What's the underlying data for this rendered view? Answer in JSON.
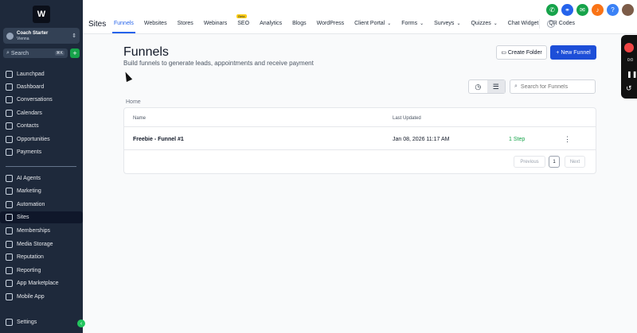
{
  "sidebar": {
    "logo_letter": "W",
    "account": {
      "name": "Coach Starter",
      "location": "Vienna"
    },
    "search": {
      "placeholder": "Search",
      "shortcut": "⌘K"
    },
    "items_top": [
      {
        "label": "Launchpad"
      },
      {
        "label": "Dashboard"
      },
      {
        "label": "Conversations"
      },
      {
        "label": "Calendars"
      },
      {
        "label": "Contacts"
      },
      {
        "label": "Opportunities"
      },
      {
        "label": "Payments"
      }
    ],
    "items_bottom": [
      {
        "label": "AI Agents"
      },
      {
        "label": "Marketing"
      },
      {
        "label": "Automation"
      },
      {
        "label": "Sites",
        "active": true
      },
      {
        "label": "Memberships"
      },
      {
        "label": "Media Storage"
      },
      {
        "label": "Reputation"
      },
      {
        "label": "Reporting"
      },
      {
        "label": "App Marketplace"
      },
      {
        "label": "Mobile App"
      }
    ],
    "settings_label": "Settings"
  },
  "header": {
    "title": "Sites",
    "tabs": [
      {
        "label": "Funnels",
        "active": true
      },
      {
        "label": "Websites"
      },
      {
        "label": "Stores"
      },
      {
        "label": "Webinars"
      },
      {
        "label": "SEO",
        "badge": "Beta"
      },
      {
        "label": "Analytics"
      },
      {
        "label": "Blogs"
      },
      {
        "label": "WordPress"
      },
      {
        "label": "Client Portal",
        "dropdown": true
      },
      {
        "label": "Forms",
        "dropdown": true
      },
      {
        "label": "Surveys",
        "dropdown": true
      },
      {
        "label": "Quizzes",
        "dropdown": true
      },
      {
        "label": "Chat Widget"
      },
      {
        "label": "QR Codes"
      }
    ],
    "icons": [
      {
        "name": "phone-icon",
        "color": "#16a34a"
      },
      {
        "name": "link-icon",
        "color": "#2563eb"
      },
      {
        "name": "megaphone-icon",
        "color": "#16a34a"
      },
      {
        "name": "notification-icon",
        "color": "#f97316"
      },
      {
        "name": "help-icon",
        "color": "#3b82f6"
      },
      {
        "name": "avatar",
        "color": "#7c5c48"
      }
    ]
  },
  "main": {
    "title": "Funnels",
    "subtitle": "Build funnels to generate leads, appointments and receive payment",
    "create_folder_label": "Create Folder",
    "new_funnel_label": "+ New Funnel",
    "search_placeholder": "Search for Funnels",
    "breadcrumb": "Home",
    "table": {
      "columns": [
        "Name",
        "Last Updated"
      ],
      "rows": [
        {
          "name": "Freebie - Funnel #1",
          "updated": "Jan 08, 2026 11:17 AM",
          "steps": "1 Step"
        }
      ]
    },
    "pagination": {
      "prev": "Previous",
      "current": "1",
      "next": "Next"
    }
  },
  "recorder": {
    "time": "0:0"
  },
  "colors": {
    "accent": "#2563eb",
    "sidebar_bg": "#1e293b",
    "success": "#16a34a"
  }
}
